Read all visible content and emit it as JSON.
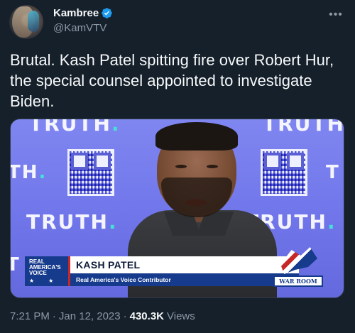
{
  "author": {
    "display_name": "Kambree",
    "handle": "@KamVTV",
    "verified": true,
    "verified_color": "#1d9bf0"
  },
  "tweet": {
    "text": "Brutal. Kash Patel spitting fire over Robert Hur, the special counsel appointed to investigate Biden."
  },
  "media": {
    "watermark": "TRUTH",
    "watermark_short": "TH",
    "watermark_prefix": "T",
    "chyron": {
      "logo_lines": [
        "REAL",
        "AMERICA'S",
        "VOICE"
      ],
      "name": "KASH PATEL",
      "title": "Real America's Voice Contributor"
    },
    "show_logo": "WAR ROOM"
  },
  "footer": {
    "time": "7:21 PM",
    "date": "Jan 12, 2023",
    "views_count": "430.3K",
    "views_label": "Views"
  },
  "icons": {
    "more": "more-horizontal-icon",
    "verified": "verified-badge-icon"
  },
  "colors": {
    "background": "#15202b",
    "text_primary": "#f7f9f9",
    "text_secondary": "#8b98a5"
  }
}
